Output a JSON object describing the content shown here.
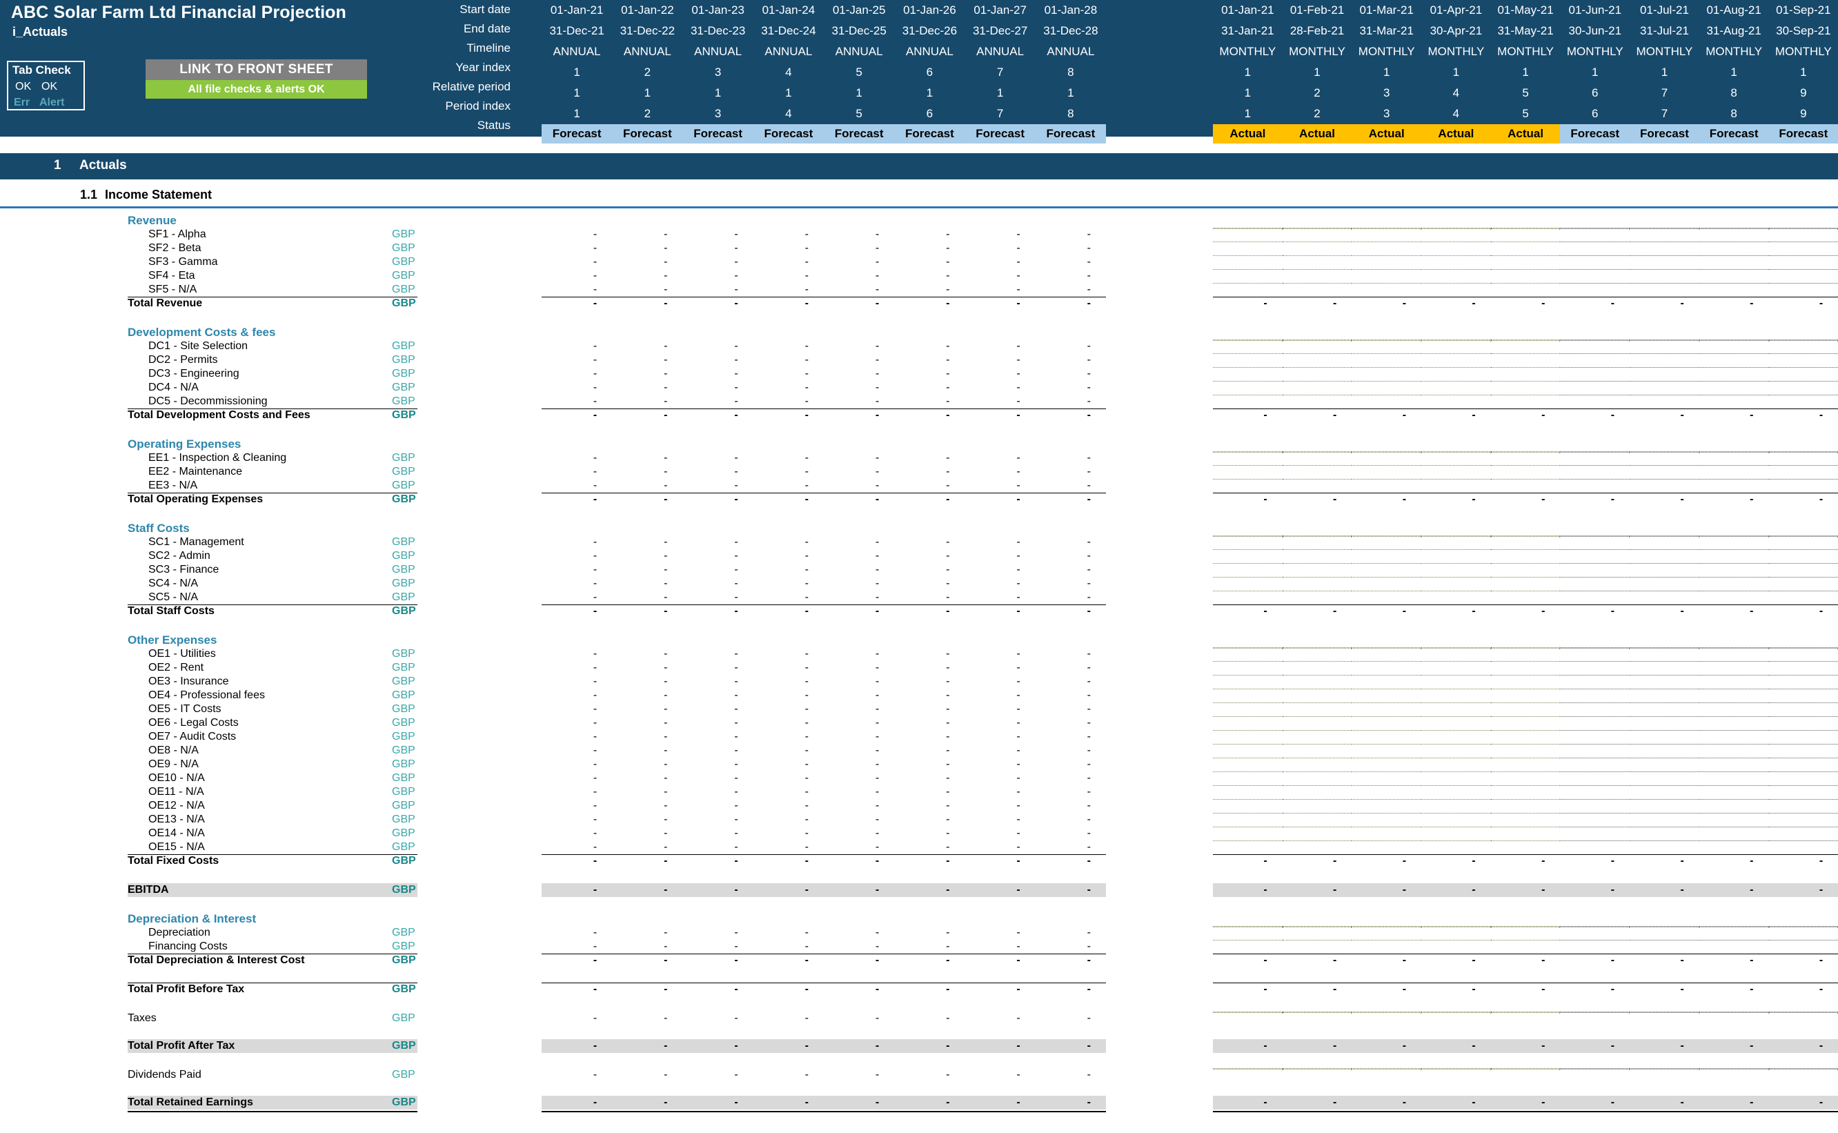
{
  "header": {
    "doc_title": "ABC Solar Farm Ltd Financial Projection",
    "tab_name": "i_Actuals",
    "tab_check": {
      "title": "Tab Check",
      "ok_1": "OK",
      "ok_2": "OK",
      "err_label": "Err",
      "alert_label": "Alert"
    },
    "link_button": {
      "top_label": "LINK TO FRONT SHEET",
      "bottom_label": "All file checks & alerts OK"
    },
    "meta_labels": {
      "start_date": "Start date",
      "end_date": "End date",
      "timeline": "Timeline",
      "year_index": "Year index",
      "relative_period": "Relative period",
      "period_index": "Period index",
      "status": "Status"
    },
    "annual": {
      "start_date": [
        "01-Jan-21",
        "01-Jan-22",
        "01-Jan-23",
        "01-Jan-24",
        "01-Jan-25",
        "01-Jan-26",
        "01-Jan-27",
        "01-Jan-28"
      ],
      "end_date": [
        "31-Dec-21",
        "31-Dec-22",
        "31-Dec-23",
        "31-Dec-24",
        "31-Dec-25",
        "31-Dec-26",
        "31-Dec-27",
        "31-Dec-28"
      ],
      "timeline": [
        "ANNUAL",
        "ANNUAL",
        "ANNUAL",
        "ANNUAL",
        "ANNUAL",
        "ANNUAL",
        "ANNUAL",
        "ANNUAL"
      ],
      "year_index": [
        "1",
        "2",
        "3",
        "4",
        "5",
        "6",
        "7",
        "8"
      ],
      "relative_period": [
        "1",
        "1",
        "1",
        "1",
        "1",
        "1",
        "1",
        "1"
      ],
      "period_index": [
        "1",
        "2",
        "3",
        "4",
        "5",
        "6",
        "7",
        "8"
      ],
      "status": [
        "Forecast",
        "Forecast",
        "Forecast",
        "Forecast",
        "Forecast",
        "Forecast",
        "Forecast",
        "Forecast"
      ]
    },
    "monthly": {
      "start_date": [
        "01-Jan-21",
        "01-Feb-21",
        "01-Mar-21",
        "01-Apr-21",
        "01-May-21",
        "01-Jun-21",
        "01-Jul-21",
        "01-Aug-21",
        "01-Sep-21"
      ],
      "end_date": [
        "31-Jan-21",
        "28-Feb-21",
        "31-Mar-21",
        "30-Apr-21",
        "31-May-21",
        "30-Jun-21",
        "31-Jul-21",
        "31-Aug-21",
        "30-Sep-21"
      ],
      "timeline": [
        "MONTHLY",
        "MONTHLY",
        "MONTHLY",
        "MONTHLY",
        "MONTHLY",
        "MONTHLY",
        "MONTHLY",
        "MONTHLY",
        "MONTHLY"
      ],
      "year_index": [
        "1",
        "1",
        "1",
        "1",
        "1",
        "1",
        "1",
        "1",
        "1"
      ],
      "relative_period": [
        "1",
        "2",
        "3",
        "4",
        "5",
        "6",
        "7",
        "8",
        "9"
      ],
      "period_index": [
        "1",
        "2",
        "3",
        "4",
        "5",
        "6",
        "7",
        "8",
        "9"
      ],
      "status": [
        "Actual",
        "Actual",
        "Actual",
        "Actual",
        "Actual",
        "Forecast",
        "Forecast",
        "Forecast",
        "Forecast"
      ]
    }
  },
  "section": {
    "number": "1",
    "title": "Actuals",
    "sub_number": "1.1",
    "sub_title": "Income Statement"
  },
  "currency": "GBP",
  "dash": "-",
  "groups": [
    {
      "name": "Revenue",
      "items": [
        "SF1 - Alpha",
        "SF2 - Beta",
        "SF3 - Gamma",
        "SF4 - Eta",
        "SF5 - N/A"
      ],
      "total": "Total Revenue"
    },
    {
      "name": "Development Costs & fees",
      "items": [
        "DC1 - Site Selection",
        "DC2 - Permits",
        "DC3 - Engineering",
        "DC4 - N/A",
        "DC5 - Decommissioning"
      ],
      "total": "Total Development Costs and Fees"
    },
    {
      "name": "Operating Expenses",
      "items": [
        "EE1 - Inspection & Cleaning",
        "EE2 - Maintenance",
        "EE3 - N/A"
      ],
      "total": "Total Operating Expenses"
    },
    {
      "name": "Staff Costs",
      "items": [
        "SC1 - Management",
        "SC2 - Admin",
        "SC3 - Finance",
        "SC4 - N/A",
        "SC5 - N/A"
      ],
      "total": "Total Staff Costs"
    },
    {
      "name": "Other Expenses",
      "items": [
        "OE1 - Utilities",
        "OE2 - Rent",
        "OE3 - Insurance",
        "OE4 - Professional fees",
        "OE5 - IT Costs",
        "OE6 - Legal Costs",
        "OE7 - Audit Costs",
        "OE8 - N/A",
        "OE9 - N/A",
        "OE10 - N/A",
        "OE11 - N/A",
        "OE12 - N/A",
        "OE13 - N/A",
        "OE14 - N/A",
        "OE15 - N/A"
      ],
      "total": "Total Fixed Costs"
    }
  ],
  "ebitda_label": "EBITDA",
  "dep_group": {
    "name": "Depreciation & Interest",
    "items": [
      "Depreciation",
      "Financing Costs"
    ],
    "total": "Total Depreciation & Interest Cost"
  },
  "profit_before_tax": "Total Profit Before Tax",
  "taxes": "Taxes",
  "profit_after_tax": "Total Profit After Tax",
  "dividends": "Dividends Paid",
  "retained_earnings": "Total Retained Earnings",
  "colors": {
    "header_navy": "#17496b",
    "group_blue": "#2e86ab",
    "currency_teal": "#3aa8a8",
    "actual_amber": "#ffc000",
    "forecast_blue": "#a7cdea",
    "input_yellow": "#ffffcc",
    "locked_grey": "#d9d9d9",
    "link_green": "#8dc63f",
    "link_grey": "#808080"
  }
}
